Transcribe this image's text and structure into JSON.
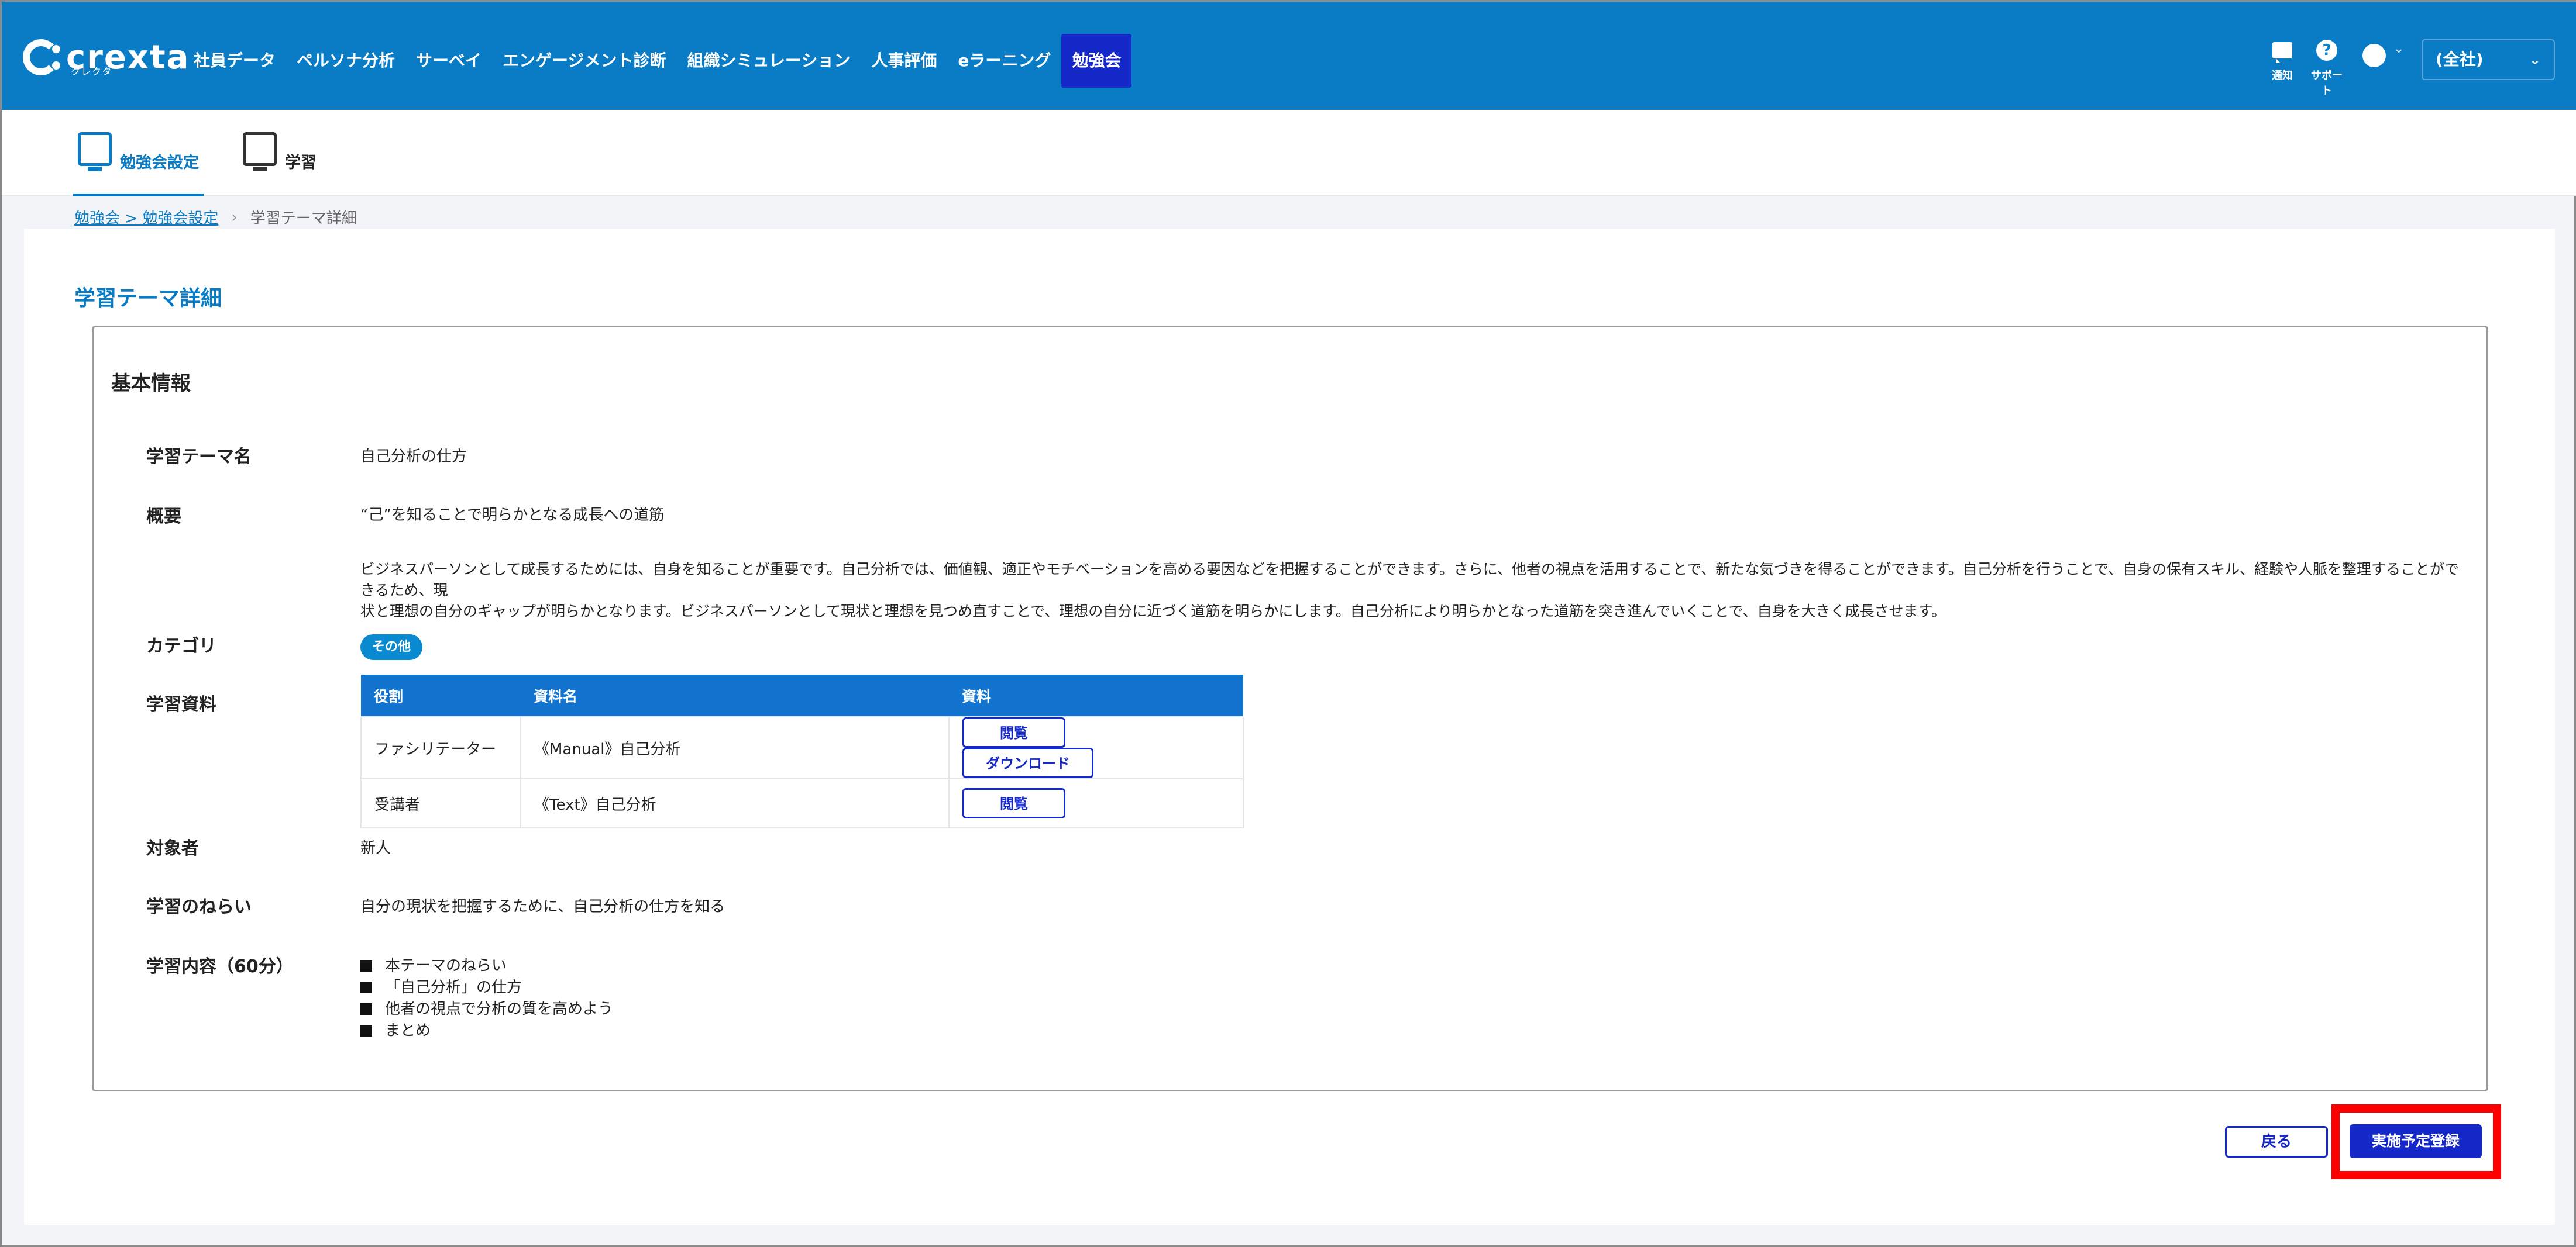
{
  "header": {
    "logo_text": "crexta",
    "logo_sub": "クレクタ",
    "nav": [
      {
        "label": "社員データ"
      },
      {
        "label": "ペルソナ分析"
      },
      {
        "label": "サーベイ"
      },
      {
        "label": "エンゲージメント診断"
      },
      {
        "label": "組織シミュレーション"
      },
      {
        "label": "人事評価"
      },
      {
        "label": "eラーニング"
      },
      {
        "label": "勉強会",
        "active": true
      }
    ],
    "notify_label": "通知",
    "support_label": "サポート",
    "org_selector": "(全社)"
  },
  "subnav": {
    "tabs": [
      {
        "label": "勉強会設定",
        "icon": "gear-monitor-icon",
        "active": true
      },
      {
        "label": "学習",
        "icon": "monitor-icon"
      }
    ]
  },
  "breadcrumb": {
    "link": "勉強会 > 勉強会設定",
    "current": "学習テーマ詳細"
  },
  "page": {
    "title": "学習テーマ詳細",
    "section_title": "基本情報",
    "fields": {
      "theme_name_label": "学習テーマ名",
      "theme_name": "自己分析の仕方",
      "summary_label": "概要",
      "summary": "“己”を知ることで明らかとなる成長への道筋",
      "description_line1": "ビジネスパーソンとして成長するためには、自身を知ることが重要です。自己分析では、価値観、適正やモチベーションを高める要因などを把握することができます。さらに、他者の視点を活用することで、新たな気づきを得ることができます。自己分析を行うことで、自身の保有スキル、経験や人脈を整理することができるため、現",
      "description_line2": "状と理想の自分のギャップが明らかとなります。ビジネスパーソンとして現状と理想を見つめ直すことで、理想の自分に近づく道筋を明らかにします。自己分析により明らかとなった道筋を突き進んでいくことで、自身を大きく成長させます。",
      "category_label": "カテゴリ",
      "category": "その他",
      "materials_label": "学習資料",
      "target_label": "対象者",
      "target": "新人",
      "aim_label": "学習のねらい",
      "aim": "自分の現状を把握するために、自己分析の仕方を知る",
      "content_label": "学習内容（60分）",
      "content_items": [
        "本テーマのねらい",
        "「自己分析」の仕方",
        "他者の視点で分析の質を高めよう",
        "まとめ"
      ]
    },
    "materials": {
      "headers": [
        "役割",
        "資料名",
        "資料"
      ],
      "rows": [
        {
          "role": "ファシリテーター",
          "name": "《Manual》自己分析",
          "view": "閲覧",
          "download": "ダウンロード"
        },
        {
          "role": "受講者",
          "name": "《Text》自己分析",
          "view": "閲覧"
        }
      ]
    },
    "actions": {
      "back": "戻る",
      "register": "実施予定登録"
    }
  },
  "colors": {
    "header_bg": "#0a7cc6",
    "active_nav": "#1528c8",
    "table_header": "#1274cf",
    "highlight": "#ff0000"
  }
}
